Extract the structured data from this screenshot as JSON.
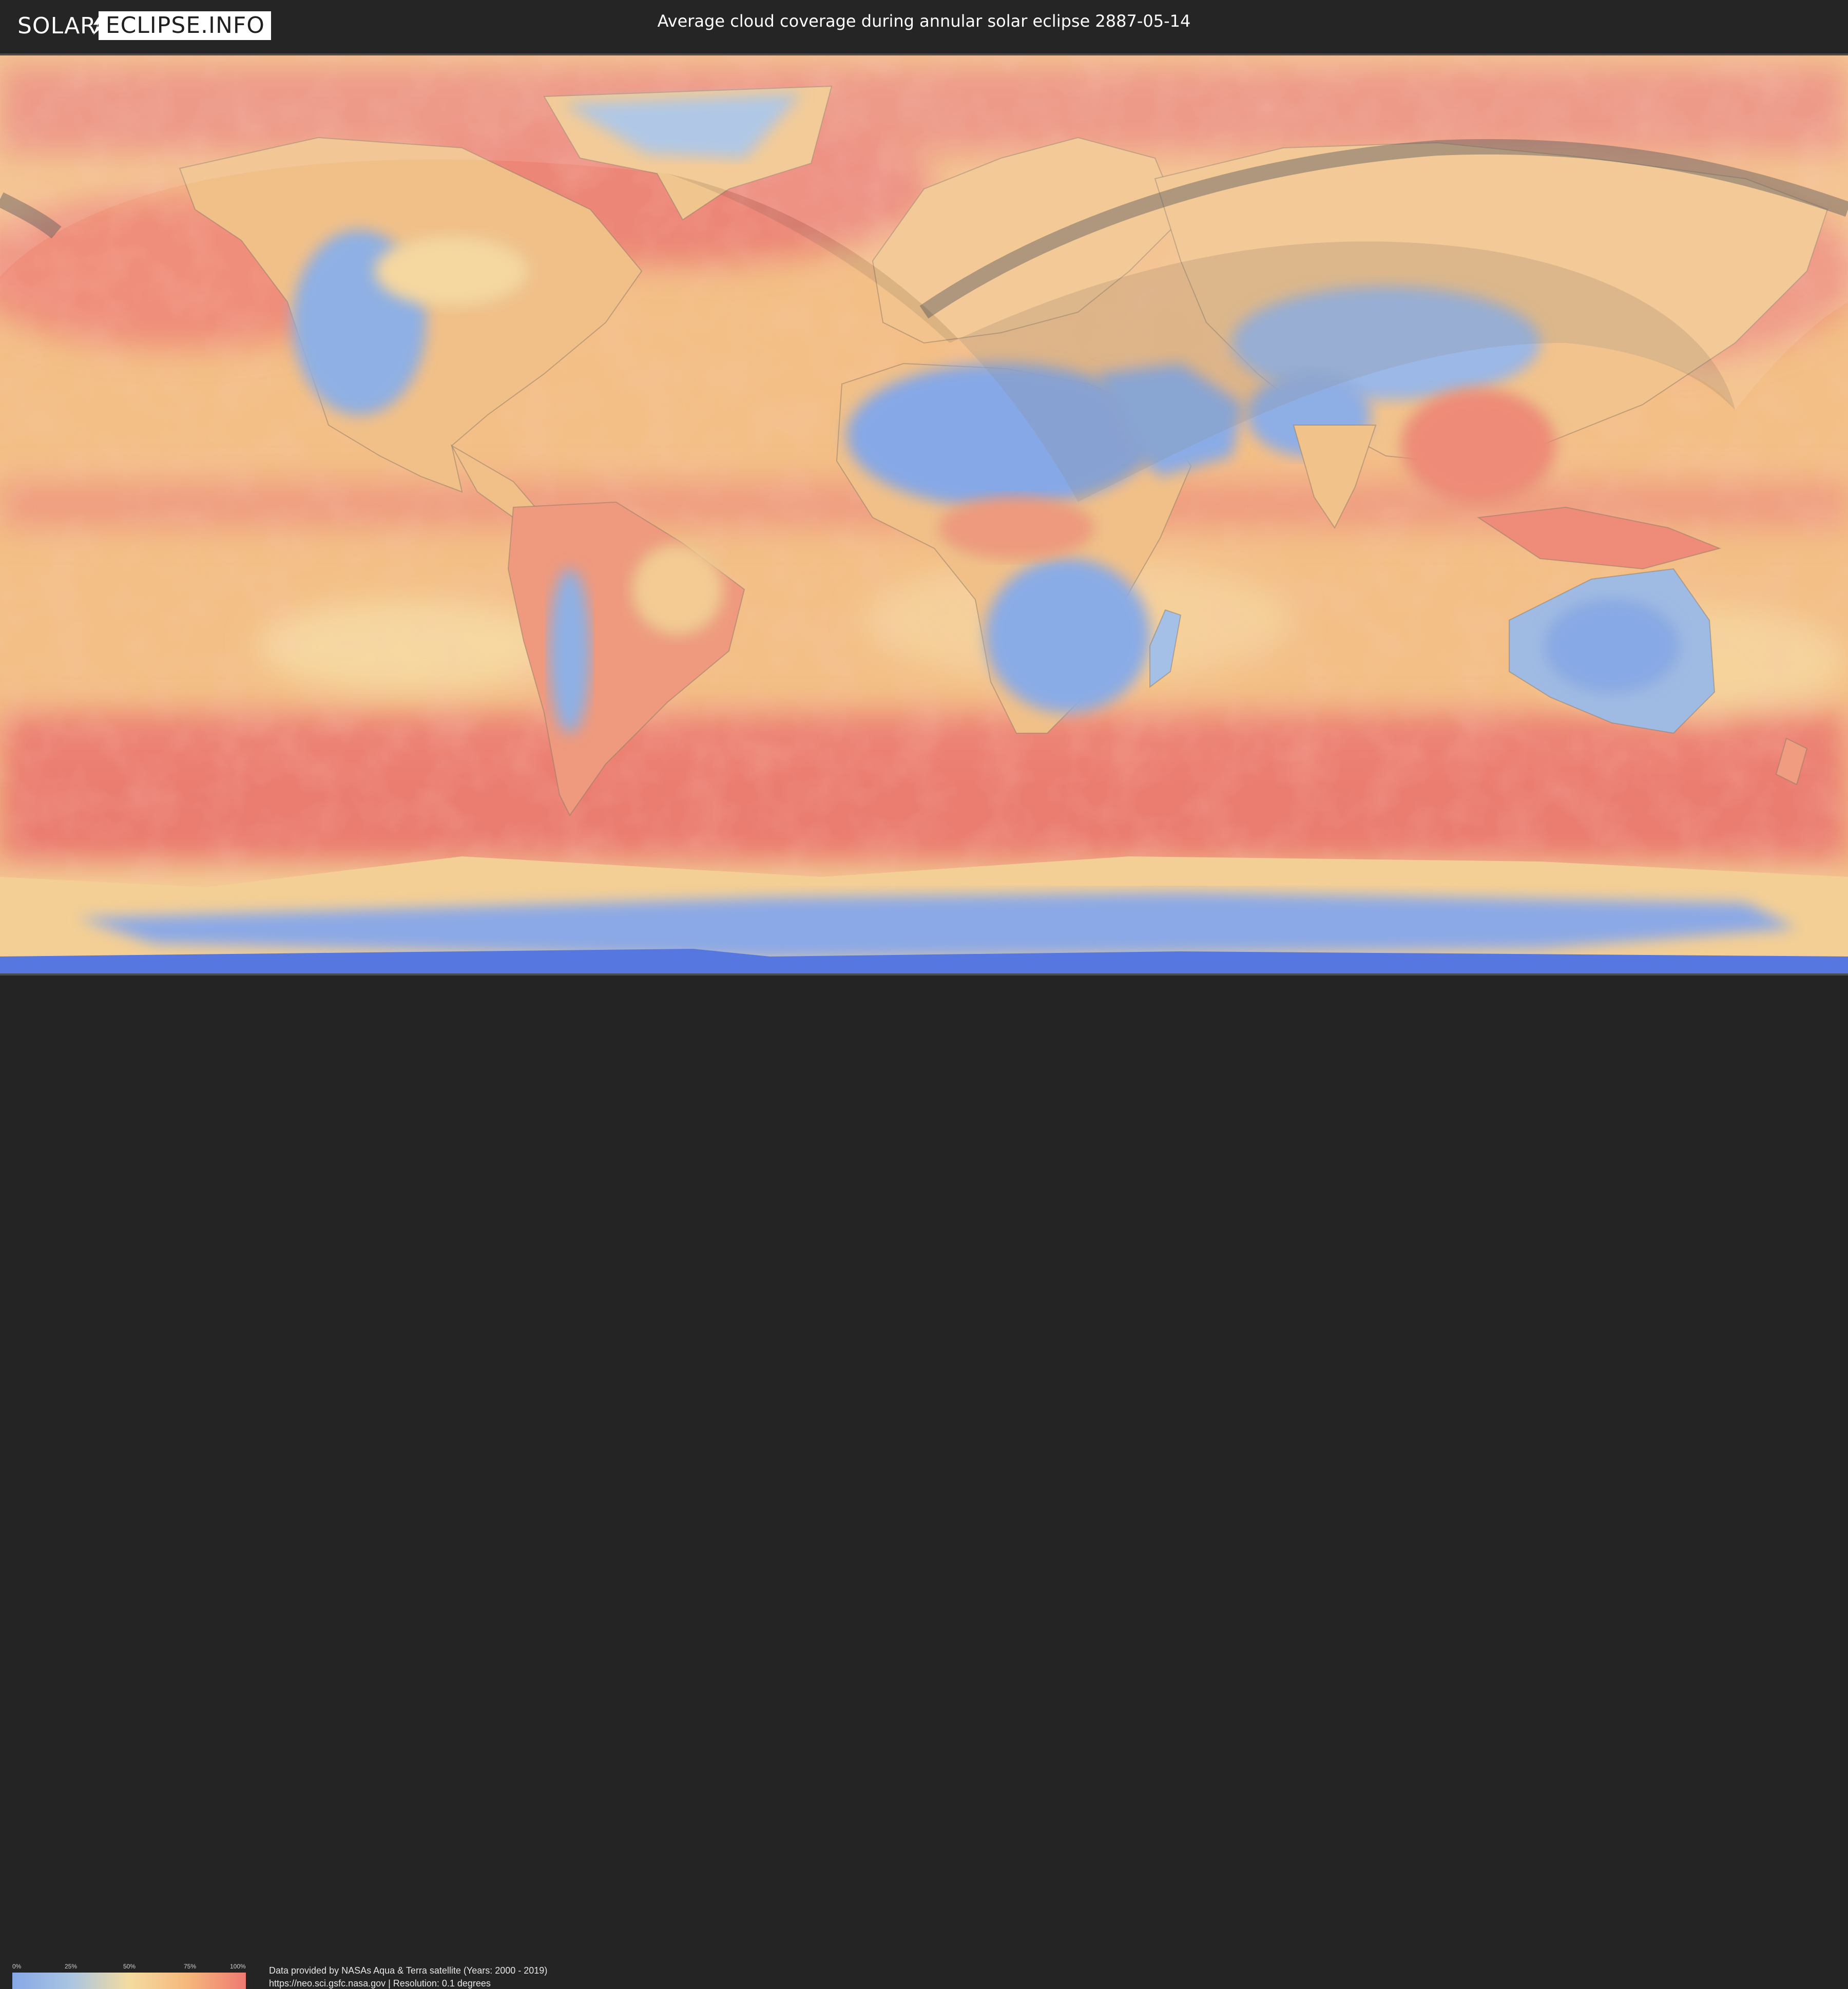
{
  "header": {
    "logo_part1": "SOLAR",
    "logo_part2": "ECLIPSE.INFO",
    "title": "Average cloud coverage during annular solar eclipse 2887-05-14"
  },
  "map": {
    "type": "cloud coverage world map",
    "overlay": "eclipse visibility zone and annular path",
    "colors": {
      "low": "#86a8e6",
      "mid": "#f4dba0",
      "high": "#ef7a72",
      "path": "#5a5a5a"
    }
  },
  "legend": {
    "ticks": [
      "0%",
      "25%",
      "50%",
      "75%",
      "100%"
    ]
  },
  "footer": {
    "credit_line1": "Data provided by NASAs Aqua & Terra satellite (Years: 2000 - 2019)",
    "credit_line2": "https://neo.sci.gsfc.nasa.gov | Resolution: 0.1 degrees"
  }
}
